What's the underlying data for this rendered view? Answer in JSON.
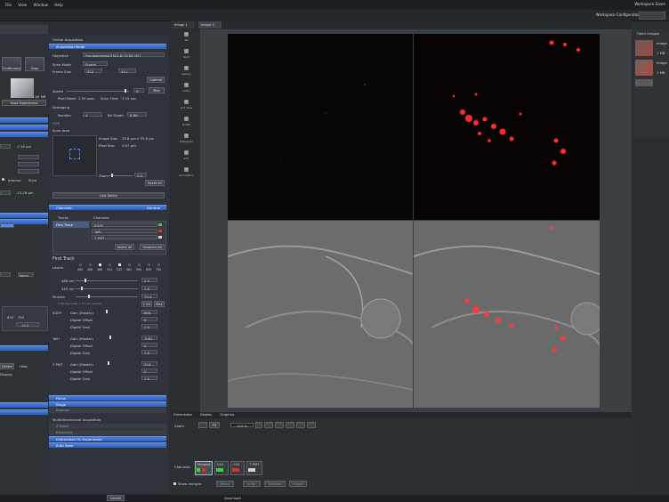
{
  "menu": [
    "File",
    "View",
    "Window",
    "Help"
  ],
  "workspace": {
    "label_top": "Workspace Zoom",
    "config_label": "Workspace Configuration"
  },
  "left_panel": {
    "buttons": {
      "continuous": "Continuous",
      "snap": "Snap",
      "start_experiment": "Start Experiment"
    },
    "size_label": "1.00 MB",
    "values": {
      "v1": "-7.16 μm",
      "v2": "-13.26 μm",
      "v3": "633",
      "v4": "750",
      "v5": "10.0"
    },
    "checkbox_labels": {
      "interval": "Interval",
      "slice": "Slice",
      "hide": "Hide",
      "delete": "Delete",
      "display": "Display",
      "none": "None"
    }
  },
  "acquisition": {
    "header": "Online Acquisition",
    "acq_mode": "Acquisition Mode",
    "objective_label": "Objective",
    "objective_value": "Plan-Apochromat 63x/1.40 Oil DIC M27",
    "scan_mode_label": "Scan Mode",
    "scan_mode_value": "Frame",
    "frame_size_label": "Frame Size",
    "frame_size_x": "512",
    "frame_size_y": "512",
    "optimal": "Optimal",
    "speed_label": "Speed",
    "speed_value": "9",
    "max_label": "Max",
    "pixel_dwell": "Pixel Dwell",
    "pixel_dwell_value": "2.55 µsec",
    "scan_time": "Scan Time",
    "scan_time_value": "3.15 sec",
    "averaging_label": "Averaging",
    "number_label": "Number",
    "number_value": "4",
    "bit_depth_label": "Bit Depth",
    "bit_depth_value": "8 Bit",
    "hdr_label": "HDR",
    "scan_area": "Scan Area",
    "image_size_label": "Image Size",
    "image_size_value": "33.8 µm x 33.8 µm",
    "pixel_size_label": "Pixel Size",
    "pixel_size_value": "0.07 µm",
    "zoom_label": "Zoom",
    "zoom_value": "3.5",
    "reset_all": "Reset All",
    "line_select": "Line Select",
    "channels_header": "Channels",
    "tracks_col": "Tracks",
    "channels_col": "Channels",
    "track_name": "Find Track",
    "channel_list": [
      "EGFP",
      "TaRI",
      "T PMT"
    ],
    "select_all": "Select All",
    "unselect_all": "Unselect All",
    "find_track_title": "Find Track",
    "lasers_label": "Lasers",
    "laser_lines": [
      "405",
      "458",
      "488",
      "514",
      "543",
      "561",
      "594",
      "633",
      "730"
    ],
    "laser_rows": [
      {
        "name": "488 nm",
        "value": "2.5"
      },
      {
        "name": "543 nm",
        "value": "1.0"
      }
    ],
    "pinhole_label": "Pinhole",
    "pinhole_value": "73.4",
    "pinhole_note": "1.00 Airy Units = 0.7 µm section",
    "airy_btn": "1 AU",
    "max_btn": "Max",
    "egfp_label": "EGFP",
    "tari_label": "TaRI",
    "tpmt_label": "T PMT",
    "gain_label": "Gain (Master)",
    "offset_label": "Digital Offset",
    "digital_gain_label": "Digital Gain",
    "egfp_vals": [
      "865",
      "0",
      "1.0"
    ],
    "tari_vals": [
      "1061",
      "0",
      "1.0"
    ],
    "tpmt_vals": [
      "324",
      "0",
      "1.0"
    ],
    "focus": "Focus",
    "stage": "Stage",
    "regions": "Regions",
    "multi_header": "Multidimensional Acquisition",
    "z_stack": "Z-Stack",
    "bleaching": "Bleaching",
    "info_exp": "Information On Experiment",
    "auto_save": "Auto Save",
    "show_label": "Show",
    "general_label": "General"
  },
  "tabs": {
    "tab1": "Image 1",
    "tab2": "Image 2"
  },
  "icon_column": [
    {
      "label": "2D",
      "icon": "2d-icon"
    },
    {
      "label": "Split",
      "icon": "split-icon"
    },
    {
      "label": "Gallery",
      "icon": "gallery-icon"
    },
    {
      "label": "Ortho",
      "icon": "ortho-icon"
    },
    {
      "label": "Cut View",
      "icon": "cutview-icon"
    },
    {
      "label": "Profile",
      "icon": "profile-icon"
    },
    {
      "label": "Histogram",
      "icon": "histogram-icon"
    },
    {
      "label": "Info",
      "icon": "info-icon"
    },
    {
      "label": "Annotation",
      "icon": "annotation-icon"
    }
  ],
  "bottom": {
    "tabs": [
      "Dimensions",
      "Display",
      "Graphics"
    ],
    "zoom_label": "Zoom",
    "zoom_value": "104 %",
    "fit_btn": "Fit",
    "channels_label": "Channels",
    "channel_btns": [
      "Merged",
      "Ch1",
      "Ch2",
      "T PMT"
    ],
    "show_merged": "Show merged",
    "reuse": "Reuse",
    "crop": "Crop",
    "rotation": "Rotation",
    "range": "Range"
  },
  "right_panel": {
    "title": "Open Images",
    "sizes": [
      "1 MB",
      "1 MB"
    ],
    "thumb_labels": [
      "Image",
      "Image"
    ]
  },
  "status": {
    "cancel": "Cancel",
    "status_text": "Download"
  }
}
